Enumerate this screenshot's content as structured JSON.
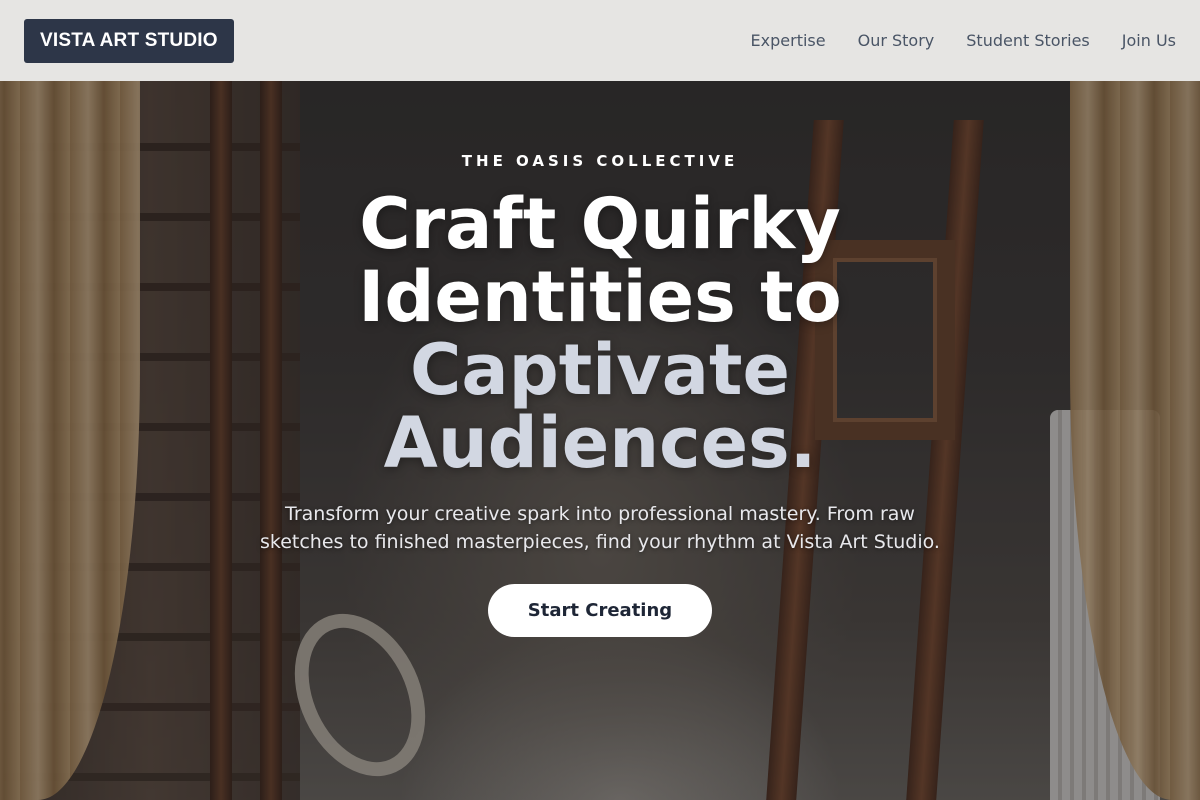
{
  "header": {
    "logo": "VISTA ART STUDIO",
    "nav": [
      {
        "label": "Expertise"
      },
      {
        "label": "Our Story"
      },
      {
        "label": "Student Stories"
      },
      {
        "label": "Join Us"
      }
    ]
  },
  "hero": {
    "eyebrow": "THE OASIS COLLECTIVE",
    "headline_line1": "Craft Quirky",
    "headline_line2": "Identities to",
    "headline_line3": "Captivate",
    "headline_line4": "Audiences.",
    "subtext": "Transform your creative spark into professional mastery. From raw sketches to finished masterpieces, find your rhythm at Vista Art Studio.",
    "cta_label": "Start Creating"
  },
  "colors": {
    "logo_bg": "#2d3648",
    "header_bg": "#e6e5e3",
    "headline_accent": "#d2d7e2",
    "cta_bg": "#ffffff"
  }
}
